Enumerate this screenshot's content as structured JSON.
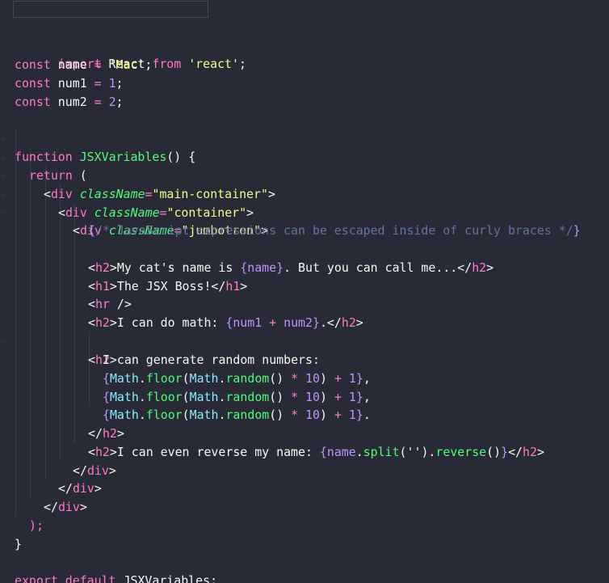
{
  "editor": {
    "background": "#282a36",
    "theme_colors": {
      "keyword": "#ff79c6",
      "string": "#f1fa8c",
      "function": "#50fa7b",
      "number": "#bd93f9",
      "comment": "#6272a4",
      "property": "#8be9fd",
      "text": "#f8f8f2"
    },
    "lines": {
      "l1": [
        "import",
        " React ",
        "from",
        " ",
        "'react'",
        ";"
      ],
      "l3": [
        "const",
        " name ",
        "=",
        " ",
        "'Mac'",
        ";"
      ],
      "l4": [
        "const",
        " num1 ",
        "=",
        " ",
        "1",
        ";"
      ],
      "l5": [
        "const",
        " num2 ",
        "=",
        " ",
        "2",
        ";"
      ],
      "l7": [
        "function",
        " ",
        "JSXVariables",
        "() {"
      ],
      "l8": [
        "return",
        " ("
      ],
      "l9": [
        "<",
        "div",
        " ",
        "className",
        "=",
        "\"main-container\"",
        ">"
      ],
      "l10": [
        "<",
        "div",
        " ",
        "className",
        "=",
        "\"container\"",
        ">"
      ],
      "l11": [
        "<",
        "div",
        " ",
        "className",
        "=",
        "\"jumbotron\"",
        ">"
      ],
      "l12": [
        "{",
        "/* JavaScript expressions can be escaped inside of curly braces */",
        "}"
      ],
      "l14": [
        "<",
        "h2",
        ">",
        "My cat's name is ",
        "{",
        "name",
        "}",
        ". But you can call me...",
        "</",
        "h2",
        ">"
      ],
      "l15": [
        "<",
        "h1",
        ">",
        "The JSX Boss!",
        "</",
        "h1",
        ">"
      ],
      "l16": [
        "<",
        "hr",
        " />"
      ],
      "l17": [
        "<",
        "h2",
        ">",
        "I can do math: ",
        "{",
        "num1",
        " + ",
        "num2",
        "}",
        ".",
        "</",
        "h2",
        ">"
      ],
      "l18": [
        "<",
        "h2",
        ">"
      ],
      "l19": [
        "I can generate random numbers:"
      ],
      "l20": [
        "{",
        "Math",
        ".",
        "floor",
        "(",
        "Math",
        ".",
        "random",
        "()",
        " * ",
        "10",
        ")",
        " + ",
        "1",
        "}",
        ","
      ],
      "l21": [
        "{",
        "Math",
        ".",
        "floor",
        "(",
        "Math",
        ".",
        "random",
        "()",
        " * ",
        "10",
        ")",
        " + ",
        "1",
        "}",
        ","
      ],
      "l22": [
        "{",
        "Math",
        ".",
        "floor",
        "(",
        "Math",
        ".",
        "random",
        "()",
        " * ",
        "10",
        ")",
        " + ",
        "1",
        "}",
        "."
      ],
      "l23": [
        "</",
        "h2",
        ">"
      ],
      "l24": [
        "<",
        "h2",
        ">",
        "I can even reverse my name: ",
        "{",
        "name",
        ".",
        "split",
        "(",
        "''",
        ").",
        "reverse",
        "()",
        "}",
        "</",
        "h2",
        ">"
      ],
      "l25": [
        "</",
        "div",
        ">"
      ],
      "l26": [
        "</",
        "div",
        ">"
      ],
      "l27": [
        "</",
        "div",
        ">"
      ],
      "l28": [
        ");"
      ],
      "l29": [
        "}"
      ],
      "l31": [
        "export",
        " ",
        "default",
        " JSXVariables;"
      ]
    }
  }
}
